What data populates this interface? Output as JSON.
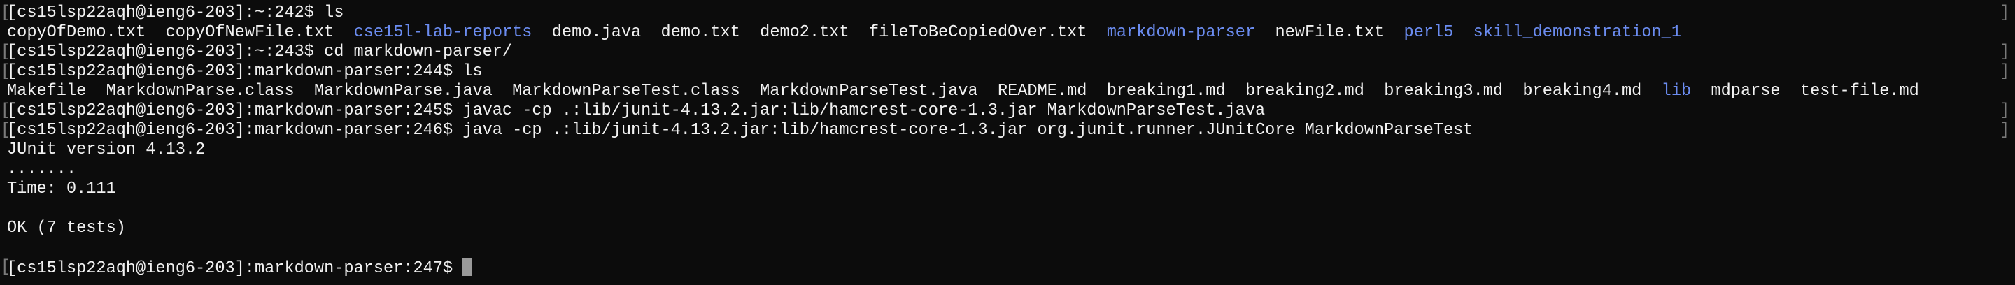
{
  "terminal": {
    "prompt_home_242": "[cs15lsp22aqh@ieng6-203]:~:242$ ",
    "cmd_242": "ls",
    "ls_home": [
      {
        "name": "copyOfDemo.txt",
        "dir": false
      },
      {
        "name": "copyOfNewFile.txt",
        "dir": false
      },
      {
        "name": "cse15l-lab-reports",
        "dir": true
      },
      {
        "name": "demo.java",
        "dir": false
      },
      {
        "name": "demo.txt",
        "dir": false
      },
      {
        "name": "demo2.txt",
        "dir": false
      },
      {
        "name": "fileToBeCopiedOver.txt",
        "dir": false
      },
      {
        "name": "markdown-parser",
        "dir": true
      },
      {
        "name": "newFile.txt",
        "dir": false
      },
      {
        "name": "perl5",
        "dir": true
      },
      {
        "name": "skill_demonstration_1",
        "dir": true
      }
    ],
    "prompt_home_243": "[cs15lsp22aqh@ieng6-203]:~:243$ ",
    "cmd_243": "cd markdown-parser/",
    "prompt_244": "[cs15lsp22aqh@ieng6-203]:markdown-parser:244$ ",
    "cmd_244": "ls",
    "ls_repo": [
      {
        "name": "Makefile",
        "dir": false
      },
      {
        "name": "MarkdownParse.class",
        "dir": false
      },
      {
        "name": "MarkdownParse.java",
        "dir": false
      },
      {
        "name": "MarkdownParseTest.class",
        "dir": false
      },
      {
        "name": "MarkdownParseTest.java",
        "dir": false
      },
      {
        "name": "README.md",
        "dir": false
      },
      {
        "name": "breaking1.md",
        "dir": false
      },
      {
        "name": "breaking2.md",
        "dir": false
      },
      {
        "name": "breaking3.md",
        "dir": false
      },
      {
        "name": "breaking4.md",
        "dir": false
      },
      {
        "name": "lib",
        "dir": true
      },
      {
        "name": "mdparse",
        "dir": false
      },
      {
        "name": "test-file.md",
        "dir": false
      }
    ],
    "prompt_245": "[cs15lsp22aqh@ieng6-203]:markdown-parser:245$ ",
    "cmd_245": "javac -cp .:lib/junit-4.13.2.jar:lib/hamcrest-core-1.3.jar MarkdownParseTest.java",
    "prompt_246": "[cs15lsp22aqh@ieng6-203]:markdown-parser:246$ ",
    "cmd_246": "java -cp .:lib/junit-4.13.2.jar:lib/hamcrest-core-1.3.jar org.junit.runner.JUnitCore MarkdownParseTest",
    "junit_version": "JUnit version 4.13.2",
    "dots": ".......",
    "time": "Time: 0.111",
    "result": "OK (7 tests)",
    "prompt_247": "[cs15lsp22aqh@ieng6-203]:markdown-parser:247$ ",
    "colors": {
      "background": "#0c0c0c",
      "text": "#f2f2f2",
      "directory": "#6b8cf0",
      "cursor": "#9a9a9a"
    }
  }
}
